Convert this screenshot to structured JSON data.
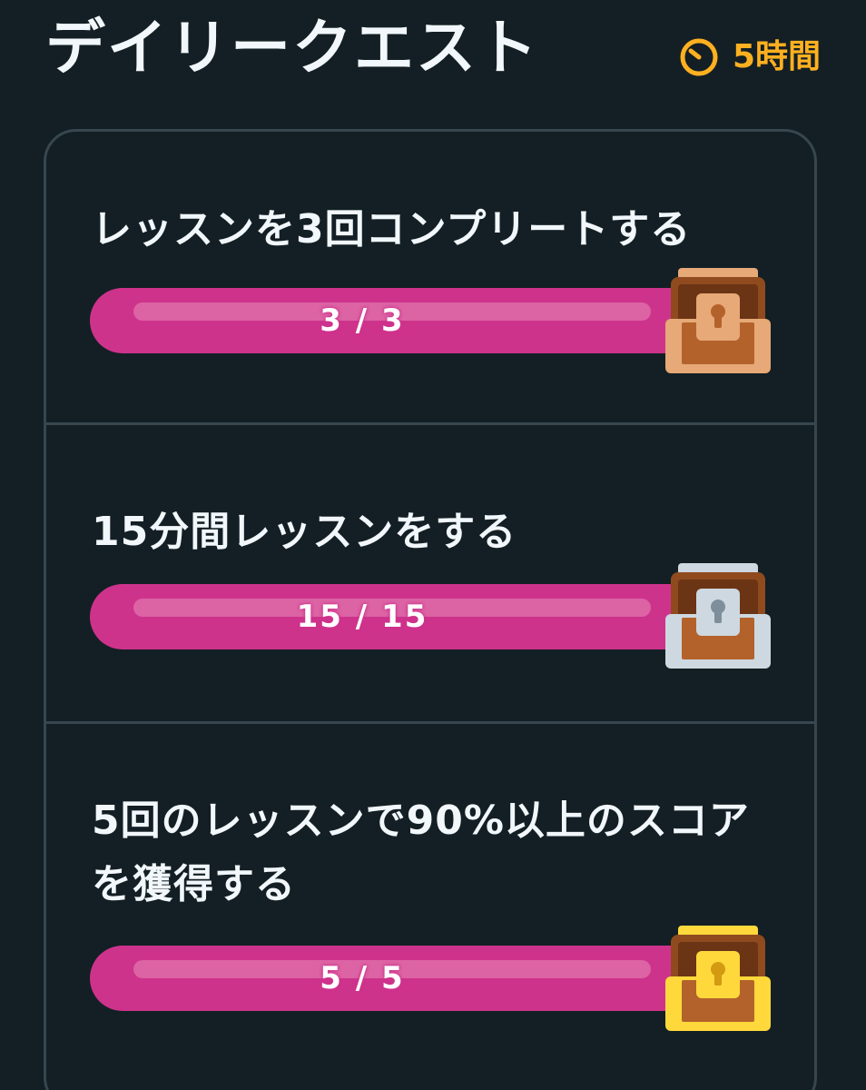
{
  "header": {
    "title": "デイリークエスト",
    "timer_icon": "timer-icon",
    "timer_text": "5時間",
    "timer_color": "#ffb020"
  },
  "quests": [
    {
      "title": "レッスンを3回コンプリートする",
      "progress_label": "3 / 3",
      "current": 3,
      "total": 3,
      "chest": "bronze-chest-icon"
    },
    {
      "title": "15分間レッスンをする",
      "progress_label": "15 / 15",
      "current": 15,
      "total": 15,
      "chest": "silver-chest-icon"
    },
    {
      "title": "5回のレッスンで90%以上のスコアを獲得する",
      "progress_label": "5 / 5",
      "current": 5,
      "total": 5,
      "chest": "gold-chest-icon"
    }
  ],
  "colors": {
    "background": "#131f24",
    "progress_fill": "#ce338c",
    "card_border": "#37464f"
  }
}
